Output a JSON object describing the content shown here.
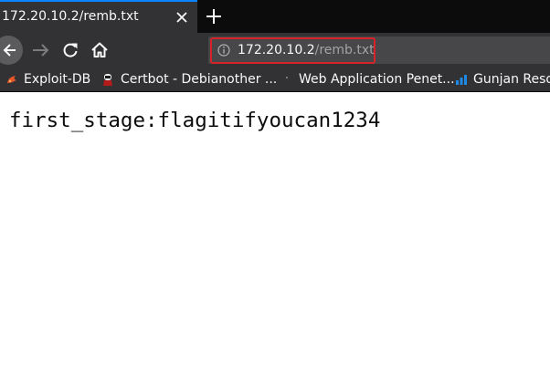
{
  "tab": {
    "title": "172.20.10.2/remb.txt",
    "close_icon": "close-icon"
  },
  "new_tab_icon": "plus-icon",
  "nav": {
    "back_icon": "back-arrow-icon",
    "forward_icon": "forward-arrow-icon",
    "reload_icon": "reload-icon",
    "home_icon": "home-icon"
  },
  "urlbar": {
    "info_icon": "info-icon",
    "host": "172.20.10.2",
    "path": "/remb.txt",
    "highlight_color": "#d7222a"
  },
  "bookmarks": [
    {
      "label": "Exploit-DB",
      "icon": "exploit-db-icon"
    },
    {
      "label": "Certbot - Debianother ...",
      "icon": "certbot-icon"
    },
    {
      "label": "Web Application Penet...",
      "icon": "web-app-icon"
    },
    {
      "label": "Gunjan Reso",
      "icon": "bar-chart-icon"
    }
  ],
  "page": {
    "text": "first_stage:flagitifyoucan1234"
  },
  "colors": {
    "tab_accent": "#0a84ff",
    "toolbar_bg": "#323234",
    "tabstrip_bg": "#0c0c0d"
  }
}
